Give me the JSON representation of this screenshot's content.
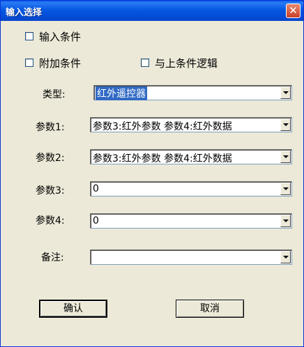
{
  "window": {
    "title": "输入选择",
    "close_glyph": "✕"
  },
  "checkboxes": {
    "input_condition": {
      "label": "输入条件",
      "checked": false
    },
    "additional_condition": {
      "label": "附加条件",
      "checked": false
    },
    "and_with_above": {
      "label": "与上条件逻辑",
      "checked": false
    }
  },
  "fields": {
    "type": {
      "label": "类型:",
      "value": "红外遥控器"
    },
    "param1": {
      "label": "参数1:",
      "value": "参数3:红外参数 参数4:红外数据"
    },
    "param2": {
      "label": "参数2:",
      "value": "参数3:红外参数 参数4:红外数据"
    },
    "param3": {
      "label": "参数3:",
      "value": "0"
    },
    "param4": {
      "label": "参数4:",
      "value": "0"
    },
    "note": {
      "label": "备注:",
      "value": ""
    }
  },
  "buttons": {
    "ok": "确认",
    "cancel": "取消"
  }
}
